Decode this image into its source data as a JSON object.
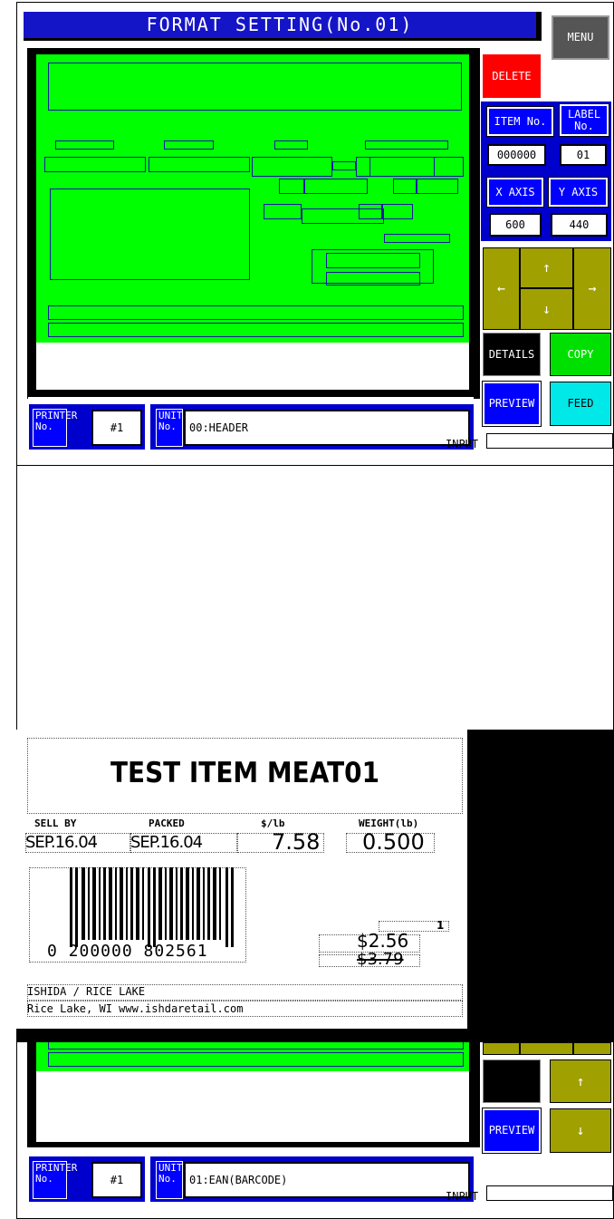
{
  "screen1": {
    "title": "FORMAT SETTING(No.01)",
    "menu": "MENU",
    "delete": "DELETE",
    "item_no_label": "ITEM No.",
    "label_no_label_1": "LABEL",
    "label_no_label_2": "No.",
    "item_no_value": "000000",
    "label_no_value": "01",
    "x_axis_label": "X AXIS",
    "y_axis_label": "Y AXIS",
    "x_axis_value": "600",
    "y_axis_value": "440",
    "arrow_up": "↑",
    "arrow_down": "↓",
    "arrow_left": "←",
    "arrow_right": "→",
    "details": "DETAILS",
    "copy": "COPY",
    "preview": "PREVIEW",
    "feed": "FEED",
    "printer_label_1": "PRINTER",
    "printer_label_2": "No.",
    "printer_value": "#1",
    "unit_label_1": "UNIT",
    "unit_label_2": "No.",
    "unit_value": "00:HEADER",
    "input_label": "INPUT"
  },
  "screen2": {
    "item_name": "TEST ITEM MEAT01",
    "sell_by_label": "SELL BY",
    "packed_label": "PACKED",
    "price_per_lb_label": "$/lb",
    "weight_label": "WEIGHT(lb)",
    "sell_by_value": "SEP.16.04",
    "packed_value": "SEP.16.04",
    "price_per_lb_value": "7.58",
    "weight_value": "0.500",
    "barcode_number": "0 200000 802561",
    "qty_value": "1",
    "total_price": "$2.56",
    "old_price": "$3.79",
    "footer_line_1": "ISHIDA / RICE LAKE",
    "footer_line_2": "Rice Lake, WI www.ishdaretail.com",
    "arrow_up": "↑",
    "arrow_down": "↓",
    "preview": "PREVIEW",
    "printer_label_1": "PRINTER",
    "printer_label_2": "No.",
    "printer_value": "#1",
    "unit_label_1": "UNIT",
    "unit_label_2": "No.",
    "unit_value": "01:EAN(BARCODE)",
    "input_label": "INPUT"
  }
}
